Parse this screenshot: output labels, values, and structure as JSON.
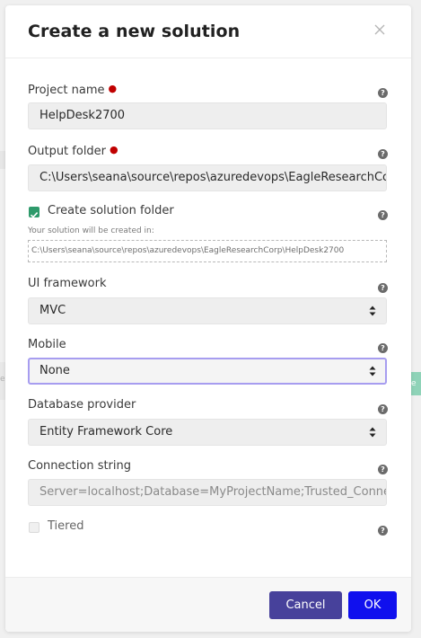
{
  "dialog": {
    "title": "Create a new solution"
  },
  "fields": {
    "project_name": {
      "label": "Project name",
      "value": "HelpDesk2700"
    },
    "output_folder": {
      "label": "Output folder",
      "value": "C:\\Users\\seana\\source\\repos\\azuredevops\\EagleResearchCorp"
    },
    "create_solution_folder": {
      "label": "Create solution folder",
      "checked": true,
      "hint": "Your solution will be created in:",
      "path": "C:\\Users\\seana\\source\\repos\\azuredevops\\EagleResearchCorp\\HelpDesk2700"
    },
    "ui_framework": {
      "label": "UI framework",
      "value": "MVC"
    },
    "mobile": {
      "label": "Mobile",
      "value": "None"
    },
    "database_provider": {
      "label": "Database provider",
      "value": "Entity Framework Core"
    },
    "connection_string": {
      "label": "Connection string",
      "placeholder": "Server=localhost;Database=MyProjectName;Trusted_Connection=True"
    },
    "tiered": {
      "label": "Tiered",
      "checked": false
    }
  },
  "icons": {
    "close": "close-icon",
    "help": "question-circle-icon",
    "select": "select-arrows-icon",
    "check": "checkmark-icon"
  },
  "footer": {
    "cancel_label": "Cancel",
    "ok_label": "OK"
  },
  "background": {
    "left_fragment": "e",
    "right_button_fragment": "ate"
  },
  "colors": {
    "cancel_button": "#47419b",
    "ok_button": "#1010ee",
    "checkbox_checked": "#2e9a6b",
    "required": "#c00000",
    "focus_border": "#a79df0"
  }
}
